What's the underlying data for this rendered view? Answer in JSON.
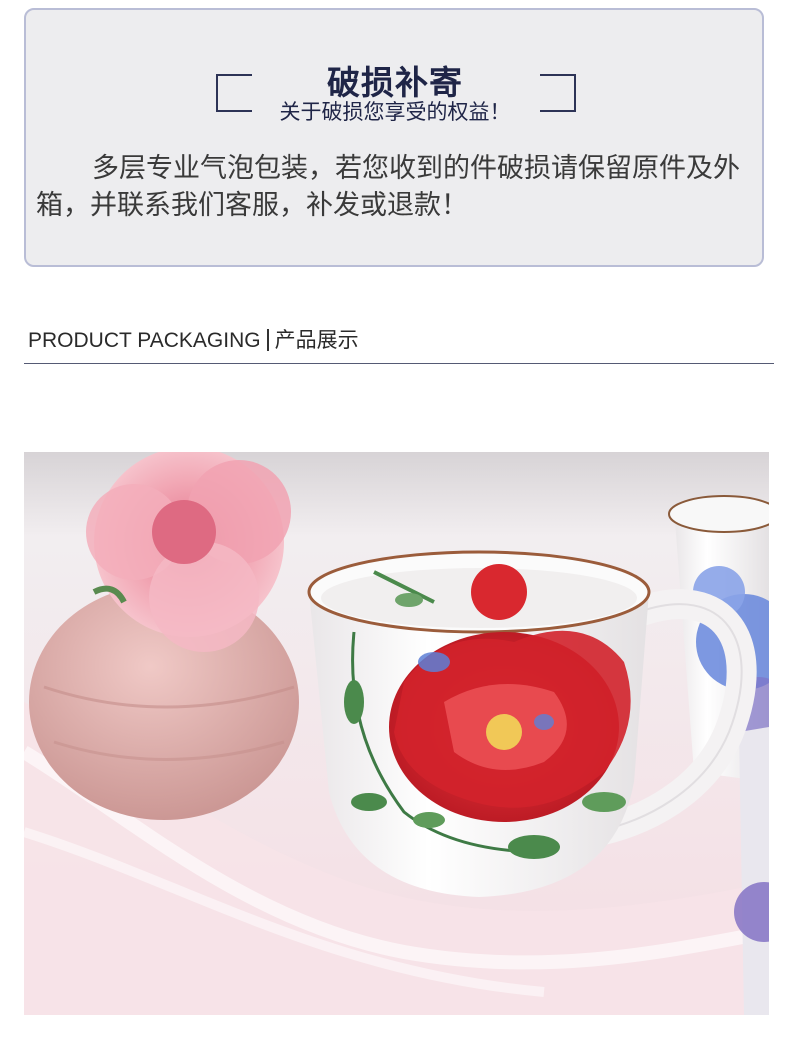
{
  "notice": {
    "title": "破损补寄",
    "subtitle": "关于破损您享受的权益！",
    "body": "多层专业气泡包装，若您收到的件破损请保留原件及外箱，并联系我们客服，补发或退款！"
  },
  "section": {
    "title_en": "PRODUCT PACKAGING",
    "title_cn": "产品展示"
  },
  "photo": {
    "subject": "product-photo",
    "colors": {
      "flower_pink": "#f0a8b4",
      "vase_pink": "#e8b7b5",
      "rose_red": "#d8262c",
      "leaf_green": "#4b8a4c",
      "blue_petal": "#5d7fd6"
    }
  }
}
